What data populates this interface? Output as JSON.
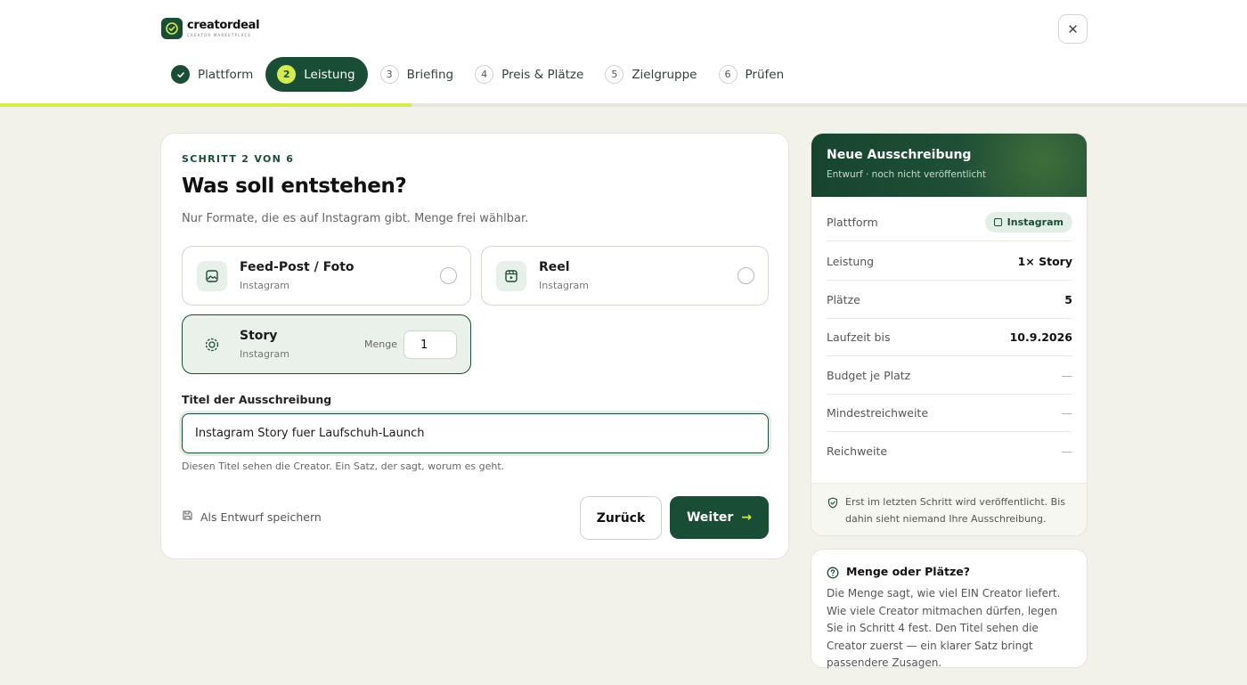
{
  "brand": {
    "name": "creatordeal",
    "tagline": "CREATOR MARKETPLACE"
  },
  "header": {
    "close_icon": "close-icon",
    "progress_pct": 33
  },
  "steps": [
    {
      "num": "1",
      "label": "Plattform",
      "state": "done"
    },
    {
      "num": "2",
      "label": "Leistung",
      "state": "active"
    },
    {
      "num": "3",
      "label": "Briefing",
      "state": "todo"
    },
    {
      "num": "4",
      "label": "Preis & Plätze",
      "state": "todo"
    },
    {
      "num": "5",
      "label": "Zielgruppe",
      "state": "todo"
    },
    {
      "num": "6",
      "label": "Prüfen",
      "state": "todo"
    }
  ],
  "main": {
    "kicker": "SCHRITT 2 VON 6",
    "title": "Was soll entstehen?",
    "subtitle": "Nur Formate, die es auf Instagram gibt. Menge frei wählbar.",
    "options": [
      {
        "title": "Feed-Post / Foto",
        "sub": "Instagram",
        "icon": "image-icon",
        "selected": false
      },
      {
        "title": "Reel",
        "sub": "Instagram",
        "icon": "reel-icon",
        "selected": false
      },
      {
        "title": "Story",
        "sub": "Instagram",
        "icon": "story-icon",
        "selected": true
      }
    ],
    "quantity": {
      "label": "Menge",
      "value": "1"
    },
    "title_field": {
      "label": "Titel der Ausschreibung",
      "value": "Instagram Story fuer Laufschuh-Launch",
      "help": "Diesen Titel sehen die Creator. Ein Satz, der sagt, worum es geht."
    },
    "save_draft": "Als Entwurf speichern",
    "back": "Zurück",
    "next": "Weiter",
    "next_arrow": "→"
  },
  "summary": {
    "title": "Neue Ausschreibung",
    "subtitle": "Entwurf · noch nicht veröffentlicht",
    "rows": [
      {
        "key": "Plattform",
        "value": "Instagram"
      },
      {
        "key": "Leistung",
        "value": "1× Story"
      },
      {
        "key": "Plätze",
        "value": "5"
      },
      {
        "key": "Laufzeit bis",
        "value": "10.9.2026"
      },
      {
        "key": "Budget je Platz",
        "value": "—"
      },
      {
        "key": "Mindestreichweite",
        "value": "—"
      },
      {
        "key": "Reichweite",
        "value": "—"
      }
    ],
    "footer": "Erst im letzten Schritt wird veröffentlicht. Bis dahin sieht niemand Ihre Ausschreibung."
  },
  "help": {
    "title": "Menge oder Plätze?",
    "body": "Die Menge sagt, wie viel EIN Creator liefert. Wie viele Creator mitmachen dürfen, legen Sie in Schritt 4 fest. Den Titel sehen die Creator zuerst — ein klarer Satz bringt passendere Zusagen."
  },
  "colors": {
    "brand": "#1a4d36",
    "accent": "#d4ec4e",
    "background": "#f2f1ea"
  }
}
